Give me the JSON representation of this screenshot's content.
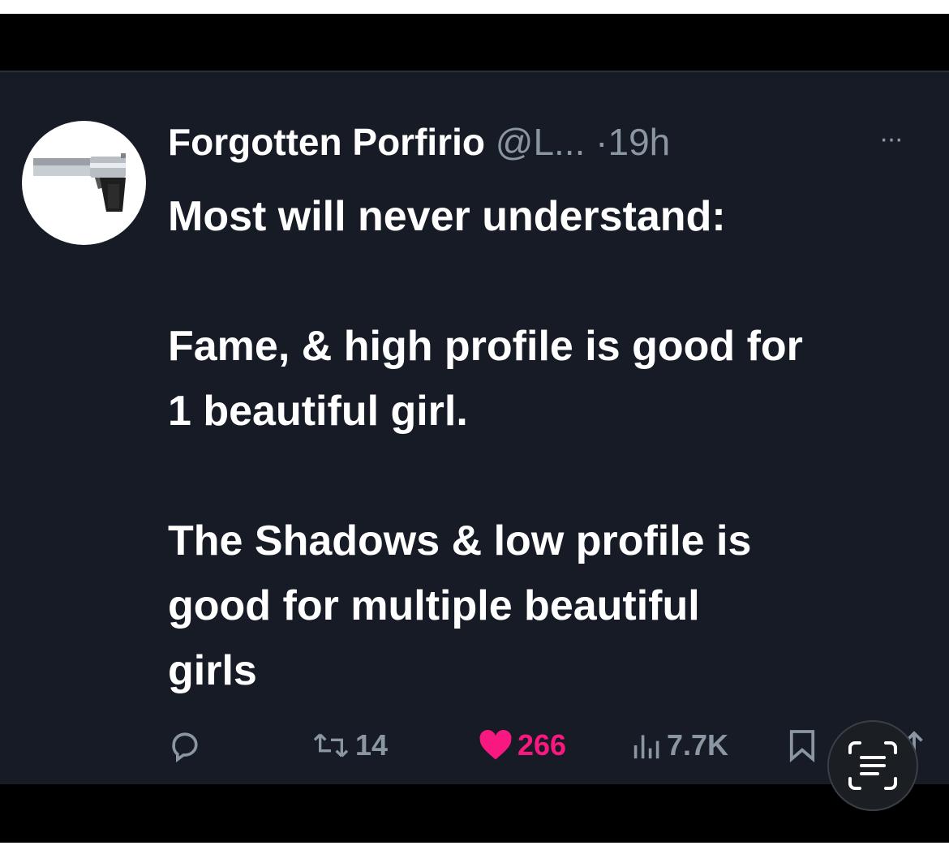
{
  "tweet": {
    "author_name": "Forgotten Porfirio",
    "handle": "@L...",
    "separator": "·",
    "time": "19h",
    "more_label": "···",
    "lines": {
      "p1": "Most will never understand:",
      "p2a": "Fame, & high profile is good for",
      "p2b": "1 beautiful girl.",
      "p3a": "The Shadows & low profile is",
      "p3b": "good for multiple beautiful",
      "p3c": "girls"
    },
    "stats": {
      "retweets": "14",
      "likes": "266",
      "views": "7.7K"
    }
  },
  "colors": {
    "background": "#161b26",
    "text": "#ffffff",
    "secondary": "#8b96a3",
    "like": "#f91880"
  },
  "icons": [
    "pistol-avatar",
    "reply-icon",
    "retweet-icon",
    "heart-icon",
    "views-icon",
    "bookmark-icon",
    "share-icon",
    "scan-text-icon"
  ]
}
